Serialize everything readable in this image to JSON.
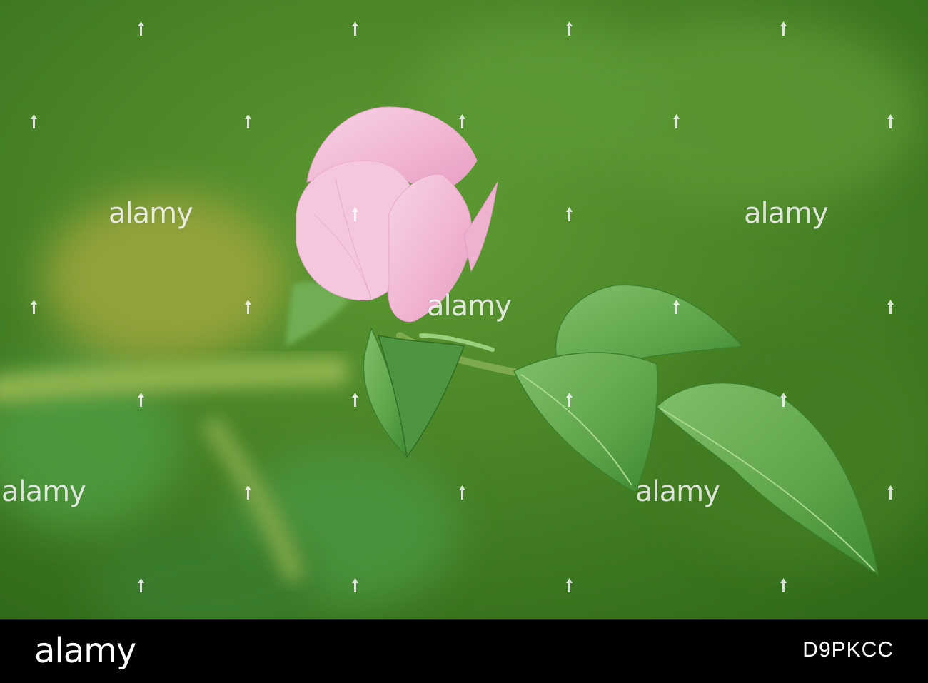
{
  "photo": {
    "subject": "pink-rose-bud-icon",
    "colors": {
      "background_green": "#4f8a2a",
      "leaf_green": "#5fa44a",
      "petal_pink": "#f3b8d6"
    }
  },
  "watermarks": {
    "text": "alamy"
  },
  "footer": {
    "brand": "alamy",
    "image_id": "D9PKCC"
  }
}
